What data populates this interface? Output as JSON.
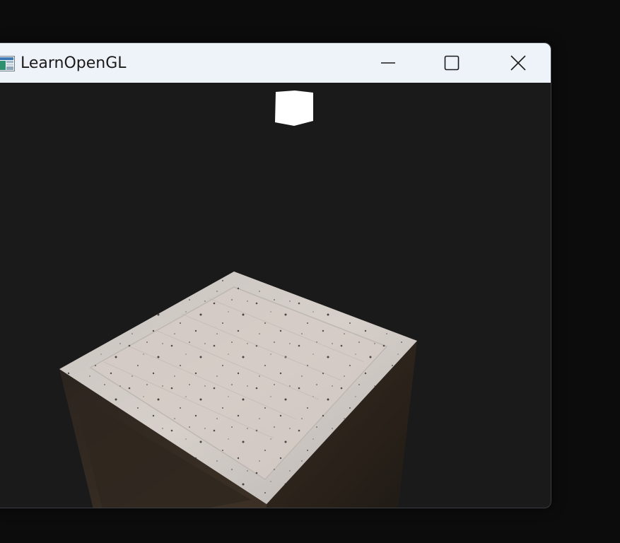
{
  "window": {
    "title": "LearnOpenGL",
    "app_icon": "opengl-app-icon",
    "controls": {
      "minimize_icon": "minimize-icon",
      "maximize_icon": "maximize-icon",
      "close_icon": "close-icon"
    }
  },
  "scene": {
    "background_color": "#1a1a1a",
    "light_source_color": "#ffffff",
    "objects": [
      "light-cube",
      "wooden-crate"
    ]
  }
}
